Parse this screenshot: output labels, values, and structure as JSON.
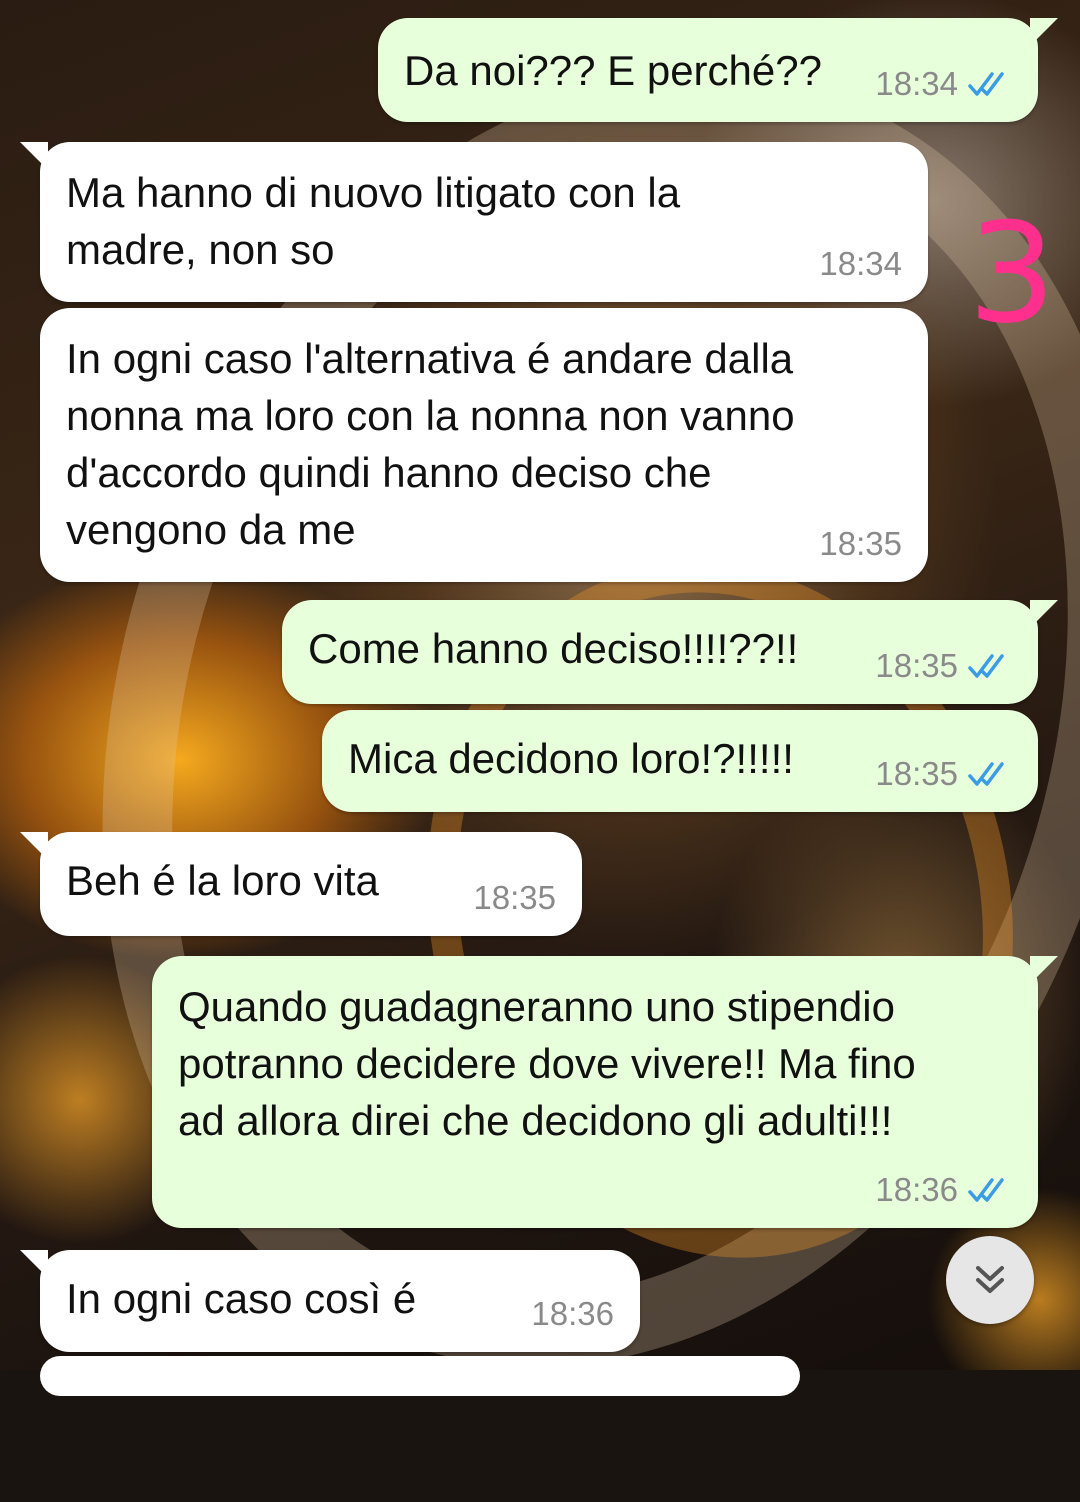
{
  "annotation": {
    "text": "3",
    "color": "#ff2f8e"
  },
  "colors": {
    "incoming_bubble": "#ffffff",
    "outgoing_bubble": "#e7ffdb",
    "read_ticks": "#3a9be6",
    "timestamp": "#8a8a8a"
  },
  "messages": [
    {
      "direction": "outgoing",
      "text": "Da noi??? E perché??",
      "time": "18:34",
      "status": "read"
    },
    {
      "direction": "incoming",
      "text": "Ma hanno di nuovo litigato con la\nmadre, non so",
      "time": "18:34"
    },
    {
      "direction": "incoming",
      "text": "In ogni caso l'alternativa é andare dalla\nnonna ma loro con la nonna non vanno\nd'accordo quindi hanno deciso che\nvengono da me",
      "time": "18:35"
    },
    {
      "direction": "outgoing",
      "text": "Come hanno deciso!!!!??!!",
      "time": "18:35",
      "status": "read"
    },
    {
      "direction": "outgoing",
      "text": "Mica decidono loro!?!!!!!",
      "time": "18:35",
      "status": "read"
    },
    {
      "direction": "incoming",
      "text": "Beh é la loro vita",
      "time": "18:35"
    },
    {
      "direction": "outgoing",
      "text": "Quando guadagneranno uno stipendio\npotranno decidere dove vivere!! Ma fino\nad allora direi che decidono gli adulti!!!",
      "time": "18:36",
      "status": "read"
    },
    {
      "direction": "incoming",
      "text": "In ogni caso così é",
      "time": "18:36"
    }
  ],
  "scroll_button": {
    "icon": "double-chevron-down-icon"
  }
}
